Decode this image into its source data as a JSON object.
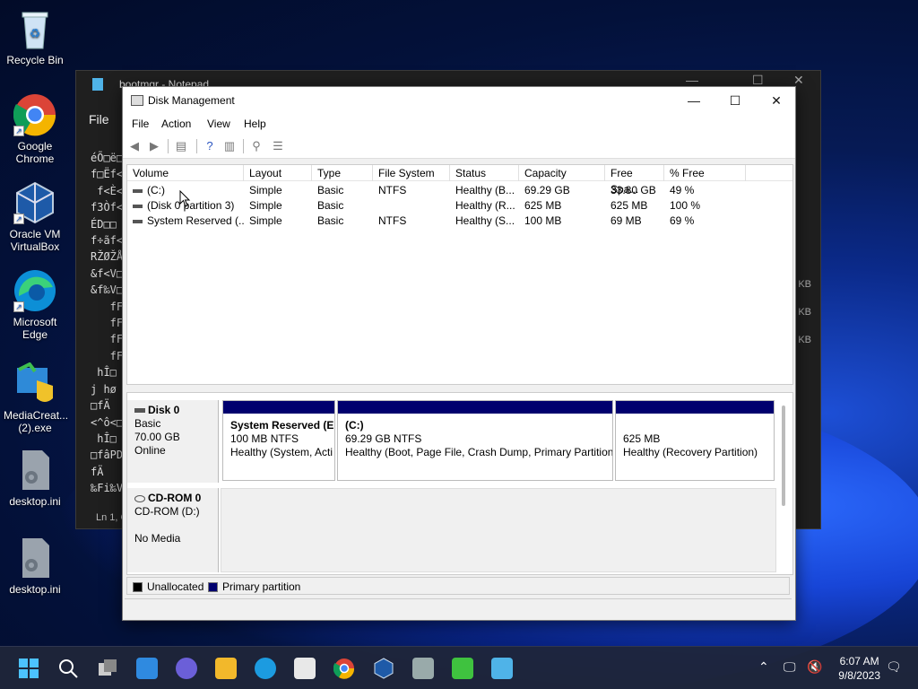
{
  "desktop": {
    "icons": [
      {
        "label": "Recycle Bin"
      },
      {
        "label": "Google Chrome"
      },
      {
        "label": "Oracle VM VirtualBox"
      },
      {
        "label": "Microsoft Edge"
      },
      {
        "label": "MediaCreat... (2).exe"
      },
      {
        "label": "desktop.ini"
      },
      {
        "label": "desktop.ini"
      }
    ]
  },
  "notepad": {
    "title": "bootmgr - Notepad",
    "menu_file": "File",
    "lines": [
      "éÕ□ë□",
      "f□Ëf<",
      " f<È<",
      "f3Òf<",
      "ÉD□□",
      "f÷ãf<",
      "RŽØŽÅ",
      "&f<V□",
      "&f‰V□",
      "   fF",
      "   fF",
      "   fF",
      "   fF",
      " hÎ□",
      "j hø",
      "□fÄ",
      "<^ô<□",
      " hÎ□",
      "□fâPD",
      "fÄ",
      "‰Fi‰V□"
    ],
    "status": "Ln 1, C",
    "side_units": [
      "KB",
      "KB",
      "KB"
    ]
  },
  "disk_mgmt": {
    "title": "Disk Management",
    "menu": [
      "File",
      "Action",
      "View",
      "Help"
    ],
    "columns": [
      "Volume",
      "Layout",
      "Type",
      "File System",
      "Status",
      "Capacity",
      "Free Spa...",
      "% Free"
    ],
    "volumes": [
      {
        "volume": "(C:)",
        "layout": "Simple",
        "type": "Basic",
        "fs": "NTFS",
        "status": "Healthy (B...",
        "capacity": "69.29 GB",
        "free": "33.80 GB",
        "pct": "49 %"
      },
      {
        "volume": "(Disk 0 partition 3)",
        "layout": "Simple",
        "type": "Basic",
        "fs": "",
        "status": "Healthy (R...",
        "capacity": "625 MB",
        "free": "625 MB",
        "pct": "100 %"
      },
      {
        "volume": "System Reserved (...",
        "layout": "Simple",
        "type": "Basic",
        "fs": "NTFS",
        "status": "Healthy (S...",
        "capacity": "100 MB",
        "free": "69 MB",
        "pct": "69 %"
      }
    ],
    "disks": [
      {
        "name": "Disk 0",
        "type": "Basic",
        "size": "70.00 GB",
        "state": "Online"
      },
      {
        "name": "CD-ROM 0",
        "type": "CD-ROM (D:)",
        "size": "",
        "state": "No Media"
      }
    ],
    "partitions": [
      {
        "title": "System Reserved  (E",
        "line1": "100 MB NTFS",
        "line2": "Healthy (System, Acti"
      },
      {
        "title": "(C:)",
        "line1": "69.29 GB NTFS",
        "line2": "Healthy (Boot, Page File, Crash Dump, Primary Partition"
      },
      {
        "title": "",
        "line1": "625 MB",
        "line2": "Healthy (Recovery Partition)"
      }
    ],
    "legend": [
      {
        "label": "Unallocated",
        "color": "#000000"
      },
      {
        "label": "Primary partition",
        "color": "#00006e"
      }
    ]
  },
  "taskbar": {
    "time": "6:07 AM",
    "date": "9/8/2023"
  }
}
